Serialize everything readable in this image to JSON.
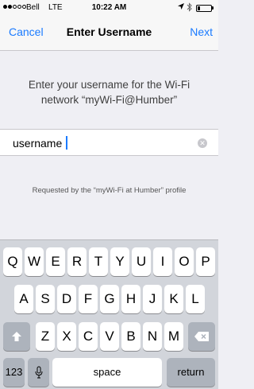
{
  "status_bar": {
    "signal_dots": [
      true,
      true,
      false,
      false,
      false
    ],
    "carrier": "Bell",
    "network": "LTE",
    "time": "10:22 AM",
    "location_icon": "location-arrow",
    "bluetooth_icon": "bluetooth",
    "battery_level": 0.2
  },
  "nav": {
    "cancel_label": "Cancel",
    "title": "Enter Username",
    "next_label": "Next"
  },
  "prompt": {
    "line1": "Enter your username for the Wi-Fi",
    "line2": "network “myWi-Fi@Humber”"
  },
  "username_field": {
    "value": "username"
  },
  "footnote": "Requested by the “myWi-Fi at Humber” profile",
  "keyboard": {
    "row1": [
      "Q",
      "W",
      "E",
      "R",
      "T",
      "Y",
      "U",
      "I",
      "O",
      "P"
    ],
    "row2": [
      "A",
      "S",
      "D",
      "F",
      "G",
      "H",
      "J",
      "K",
      "L"
    ],
    "row3": [
      "Z",
      "X",
      "C",
      "V",
      "B",
      "N",
      "M"
    ],
    "shift_icon": "shift-arrow",
    "delete_icon": "backspace",
    "numbers_label": "123",
    "mic_icon": "microphone",
    "space_label": "space",
    "return_label": "return"
  }
}
